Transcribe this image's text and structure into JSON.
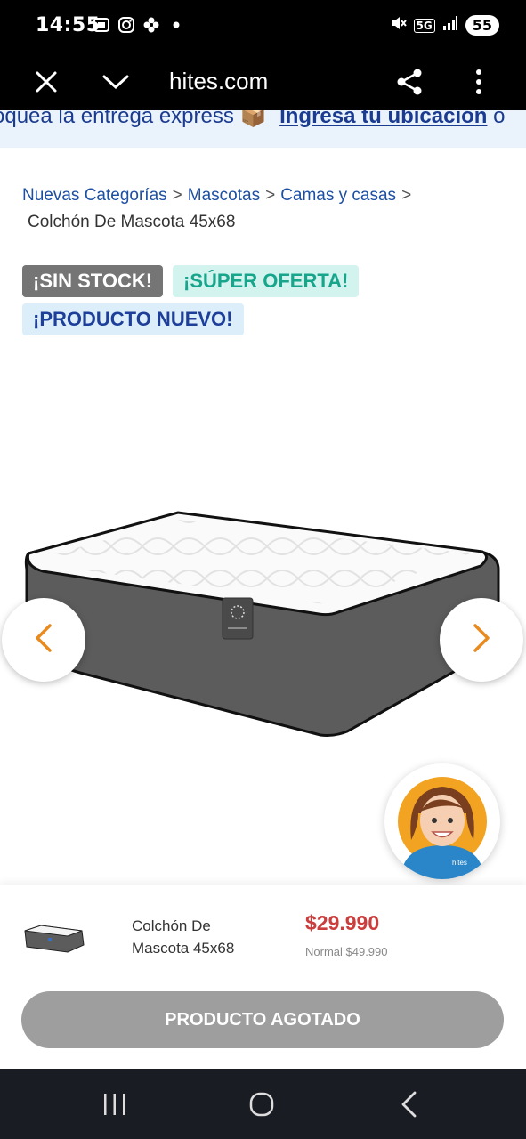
{
  "status_bar": {
    "time": "14:55",
    "network": "5G",
    "battery": "55",
    "icons": [
      "screen-recorder-icon",
      "instagram-icon",
      "flower-icon",
      "dot-icon",
      "mute-icon",
      "signal-icon"
    ]
  },
  "browser": {
    "url": "hites.com",
    "icons": [
      "close-icon",
      "chevron-down-icon",
      "share-icon",
      "more-vert-icon"
    ]
  },
  "banner": {
    "text": "oquea la entrega express 📦",
    "link": "Ingresa tu ubicación",
    "tail": "ó"
  },
  "breadcrumb": {
    "items": [
      "Nuevas Categorías",
      "Mascotas",
      "Camas y casas"
    ],
    "separator": ">",
    "current": "Colchón De Mascota 45x68"
  },
  "badges": {
    "sin_stock": "¡SIN STOCK!",
    "super_oferta": "¡SÚPER OFERTA!",
    "producto_nuevo": "¡PRODUCTO NUEVO!"
  },
  "product": {
    "name": "Colchón De Mascota 45x68",
    "price": "$29.990",
    "normal_price": "Normal $49.990"
  },
  "assistant": {
    "logo": "hites"
  },
  "cta": {
    "label": "PRODUCTO AGOTADO"
  },
  "colors": {
    "link_blue": "#1d4fa3",
    "price_red": "#cc3d3d",
    "badge_grey": "#757575",
    "offer_teal": "#17a58c",
    "nav_orange": "#e98a1f"
  }
}
